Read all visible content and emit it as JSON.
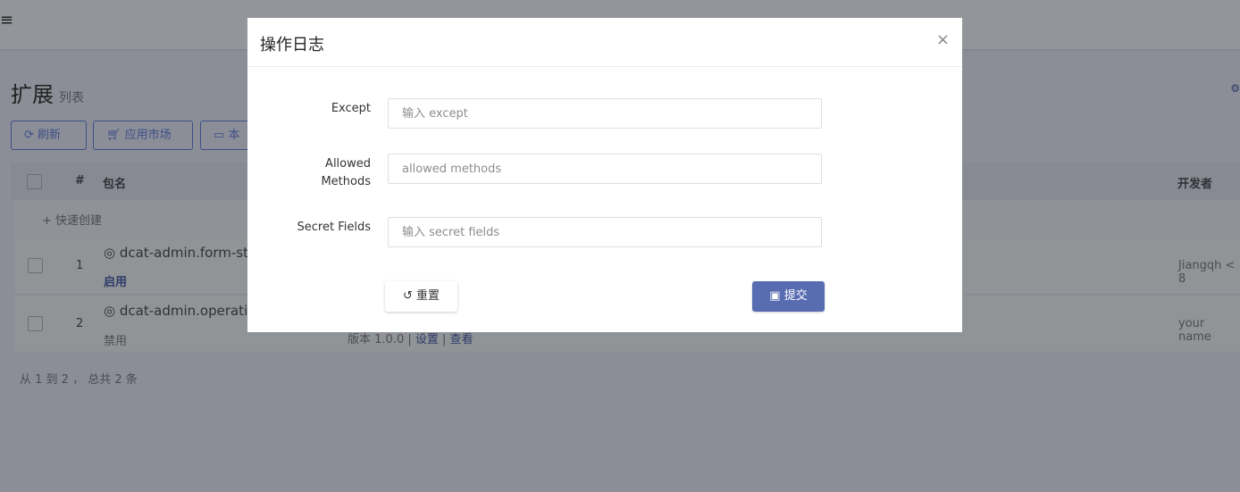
{
  "header": {
    "menu_icon": "≡"
  },
  "page": {
    "title": "扩展",
    "subtitle": "列表"
  },
  "toolbar": {
    "refresh": "刷新",
    "market": "应用市场",
    "local": "本"
  },
  "table": {
    "headers": {
      "index": "#",
      "name": "包名",
      "developer": "开发者"
    },
    "quick_create": "+ 快速创建",
    "rows": [
      {
        "index": "1",
        "name": "dcat-admin.form-st",
        "status": "启用",
        "developer": "Jiangqh < 8"
      },
      {
        "index": "2",
        "name": "dcat-admin.operatio",
        "status": "禁用",
        "version": "版本 1.0.0",
        "settings": "设置",
        "view": "查看",
        "developer": "your name"
      }
    ],
    "pagination": "从 1 到 2 ， 总共 2 条"
  },
  "modal": {
    "title": "操作日志",
    "close": "×",
    "fields": [
      {
        "label": "Except",
        "placeholder": "输入 except"
      },
      {
        "label": "Allowed Methods",
        "placeholder": "allowed methods"
      },
      {
        "label": "Secret Fields",
        "placeholder": "输入 secret fields"
      }
    ],
    "reset": "重置",
    "submit": "提交"
  },
  "colors": {
    "primary": "#586cb1"
  }
}
